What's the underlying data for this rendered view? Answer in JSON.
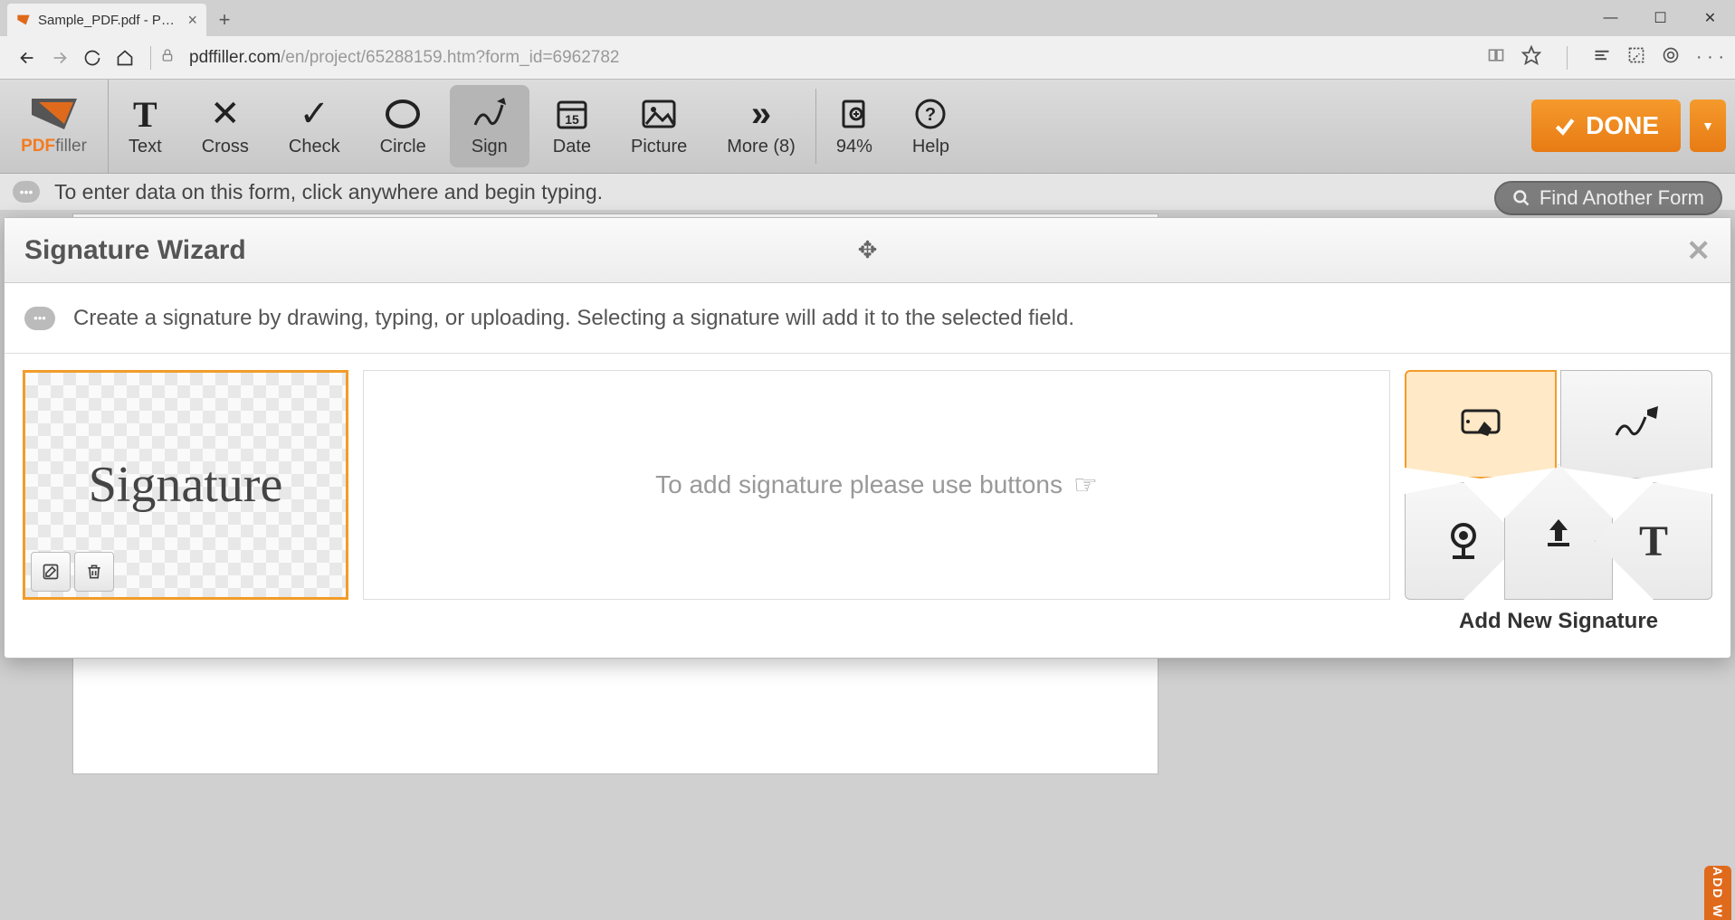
{
  "browser": {
    "tab_title": "Sample_PDF.pdf - PDFfi",
    "url_host": "pdffiller.com",
    "url_path": "/en/project/65288159.htm?form_id=6962782"
  },
  "app": {
    "logo_bold": "PDF",
    "logo_rest": "filler",
    "tools": {
      "text": "Text",
      "cross": "Cross",
      "check": "Check",
      "circle": "Circle",
      "sign": "Sign",
      "date": "Date",
      "picture": "Picture",
      "more": "More (8)"
    },
    "zoom": "94%",
    "help": "Help",
    "done": "DONE",
    "hint": "To enter data on this form, click anywhere and begin typing.",
    "find_form": "Find Another Form"
  },
  "modal": {
    "title": "Signature Wizard",
    "subtitle": "Create a signature by drawing, typing, or uploading. Selecting a signature will add it to the selected field.",
    "sample_signature": "Signature",
    "mid_text": "To add signature please use buttons",
    "add_label": "Add New Signature"
  },
  "side_tab": "ADD W"
}
